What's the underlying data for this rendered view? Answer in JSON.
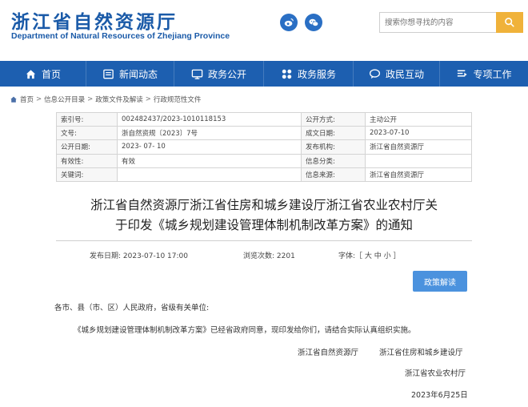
{
  "header": {
    "site_name_cn": "浙江省自然资源厅",
    "site_name_en": "Department of Natural Resources of Zhejiang Province",
    "search_placeholder": "搜索你想寻找的内容",
    "icons": [
      "weibo-icon",
      "wechat-icon",
      "search-icon"
    ],
    "accent_color": "#1d5fb0",
    "search_button_color": "#f0b23a"
  },
  "nav": {
    "items": [
      {
        "label": "首页",
        "icon": "home-icon"
      },
      {
        "label": "新闻动态",
        "icon": "news-icon"
      },
      {
        "label": "政务公开",
        "icon": "monitor-icon"
      },
      {
        "label": "政务服务",
        "icon": "grid-icon"
      },
      {
        "label": "政民互动",
        "icon": "chat-icon"
      },
      {
        "label": "专项工作",
        "icon": "list-icon"
      }
    ]
  },
  "breadcrumb": {
    "items": [
      "首页",
      "信息公开目录",
      "政策文件及解读",
      "行政规范性文件"
    ],
    "separator": ">"
  },
  "meta": {
    "rows": [
      {
        "k1": "索引号:",
        "v1": "002482437/2023-1010118153",
        "k2": "公开方式:",
        "v2": "主动公开"
      },
      {
        "k1": "文号:",
        "v1": "浙自然资规〔2023〕7号",
        "k2": "成文日期:",
        "v2": "2023-07-10"
      },
      {
        "k1": "公开日期:",
        "v1": "2023- 07- 10",
        "k2": "发布机构:",
        "v2": "浙江省自然资源厅"
      },
      {
        "k1": "有效性:",
        "v1": "有效",
        "k2": "信息分类:",
        "v2": ""
      },
      {
        "k1": "关键词:",
        "v1": "",
        "k2": "信息来源:",
        "v2": "浙江省自然资源厅"
      }
    ]
  },
  "article": {
    "title_line1": "浙江省自然资源厅浙江省住房和城乡建设厅浙江省农业农村厅关",
    "title_line2": "于印发《城乡规划建设管理体制机制改革方案》的通知",
    "publish_time": "发布日期: 2023-07-10 17:00",
    "views": "浏览次数: 2201",
    "font_size": "字体:［ 大 中 小 ］",
    "policy_button": "政策解读",
    "salutation": "各市、县（市、区）人民政府，省级有关单位:",
    "body": "《城乡规划建设管理体制机制改革方案》已经省政府同意，现印发给你们，请结合实际认真组织实施。",
    "signer1": "浙江省自然资源厅",
    "signer2": "浙江省住房和城乡建设厅",
    "signer3": "浙江省农业农村厅",
    "date": "2023年6月25日"
  }
}
